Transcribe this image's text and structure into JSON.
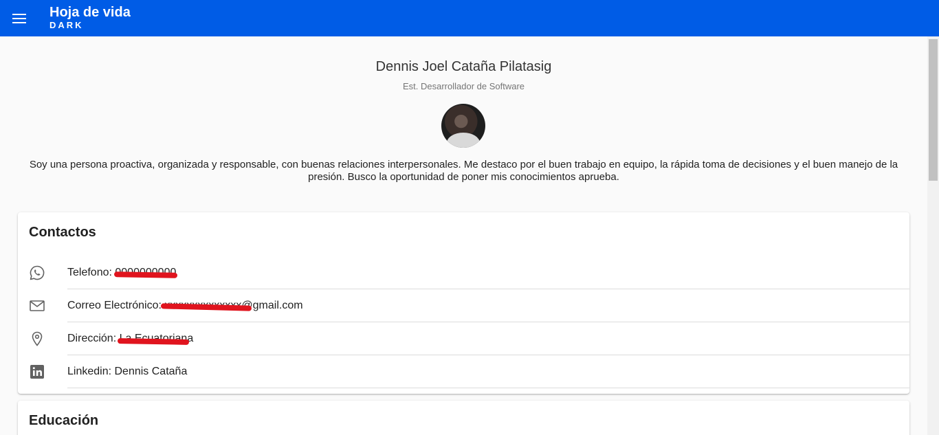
{
  "app_bar": {
    "title": "Hoja de vida",
    "subtitle": "DARK",
    "background": "#005ce6",
    "menu_icon": "menu-icon"
  },
  "profile": {
    "name": "Dennis Joel Cataña Pilatasig",
    "role": "Est. Desarrollador de Software",
    "bio": "Soy una persona proactiva, organizada y responsable, con buenas relaciones interpersonales. Me destaco por el buen trabajo en equipo, la rápida toma de decisiones y el buen manejo de la presión. Busco la oportunidad de poner mis conocimientos aprueba."
  },
  "contacts": {
    "title": "Contactos",
    "items": [
      {
        "icon": "whatsapp-icon",
        "label": "Telefono: 0000000000"
      },
      {
        "icon": "mail-icon",
        "label": "Correo Electrónico: xxxxxxxxxxxxxx@gmail.com"
      },
      {
        "icon": "location-icon",
        "label": "Dirección: La Ecuatoriana"
      },
      {
        "icon": "linkedin-icon",
        "label": "Linkedin: Dennis Cataña"
      }
    ]
  },
  "education": {
    "title": "Educación"
  },
  "colors": {
    "redaction": "#e0141e",
    "icon": "#616161"
  }
}
